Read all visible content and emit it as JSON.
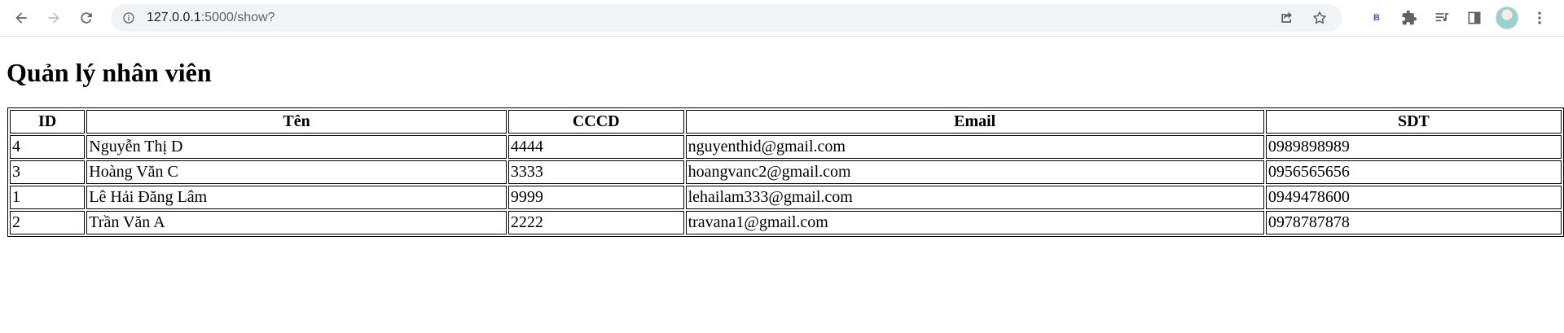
{
  "browser": {
    "url_host": "127.0.0.1",
    "url_path": ":5000/show?",
    "extension_label": "B"
  },
  "page": {
    "title": "Quản lý nhân viên"
  },
  "table": {
    "headers": [
      "ID",
      "Tên",
      "CCCD",
      "Email",
      "SDT"
    ],
    "rows": [
      [
        "4",
        "Nguyễn Thị D",
        "4444",
        "nguyenthid@gmail.com",
        "0989898989"
      ],
      [
        "3",
        "Hoàng Văn C",
        "3333",
        "hoangvanc2@gmail.com",
        "0956565656"
      ],
      [
        "1",
        "Lê Hải Đăng Lâm",
        "9999",
        "lehailam333@gmail.com",
        "0949478600"
      ],
      [
        "2",
        "Trần Văn A",
        "2222",
        "travana1@gmail.com",
        "0978787878"
      ]
    ]
  }
}
